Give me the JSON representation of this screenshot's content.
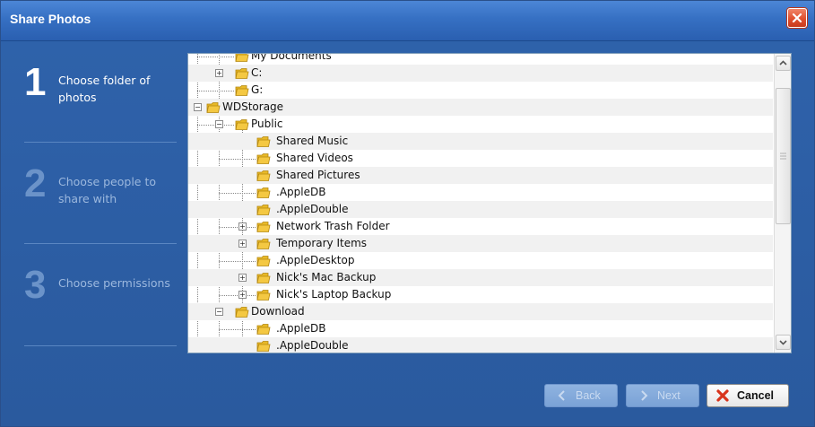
{
  "window": {
    "title": "Share Photos"
  },
  "steps": [
    {
      "number": "1",
      "label": "Choose folder of photos",
      "active": true
    },
    {
      "number": "2",
      "label": "Choose people to share with",
      "active": false
    },
    {
      "number": "3",
      "label": "Choose permissions",
      "active": false
    }
  ],
  "tree": {
    "rows": [
      {
        "label": "My Documents",
        "depth": 1,
        "expander": "none"
      },
      {
        "label": "C:",
        "depth": 1,
        "expander": "plus"
      },
      {
        "label": "G:",
        "depth": 1,
        "expander": "none"
      },
      {
        "label": "WDStorage",
        "depth": 0,
        "expander": "minus"
      },
      {
        "label": "Public",
        "depth": 1,
        "expander": "minus"
      },
      {
        "label": "Shared Music",
        "depth": 2,
        "expander": "none"
      },
      {
        "label": "Shared Videos",
        "depth": 2,
        "expander": "none"
      },
      {
        "label": "Shared Pictures",
        "depth": 2,
        "expander": "none"
      },
      {
        "label": ".AppleDB",
        "depth": 2,
        "expander": "none"
      },
      {
        "label": ".AppleDouble",
        "depth": 2,
        "expander": "none"
      },
      {
        "label": "Network Trash Folder",
        "depth": 2,
        "expander": "plus"
      },
      {
        "label": "Temporary Items",
        "depth": 2,
        "expander": "plus"
      },
      {
        "label": ".AppleDesktop",
        "depth": 2,
        "expander": "none"
      },
      {
        "label": "Nick's Mac Backup",
        "depth": 2,
        "expander": "plus"
      },
      {
        "label": "Nick's Laptop Backup",
        "depth": 2,
        "expander": "plus"
      },
      {
        "label": "Download",
        "depth": 1,
        "expander": "minus"
      },
      {
        "label": ".AppleDB",
        "depth": 2,
        "expander": "none"
      },
      {
        "label": ".AppleDouble",
        "depth": 2,
        "expander": "none"
      }
    ]
  },
  "buttons": {
    "back_label": "Back",
    "next_label": "Next",
    "cancel_label": "Cancel"
  },
  "icons": {
    "close": "close-icon",
    "folder": "folder-icon",
    "back": "back-arrow-icon",
    "next": "next-arrow-icon",
    "cancel": "cancel-x-icon"
  },
  "colors": {
    "window_bg": "#2d5fa6",
    "title_bar": "#3670c3",
    "close_red": "#e0502f",
    "folder_yellow": "#f4c842"
  }
}
